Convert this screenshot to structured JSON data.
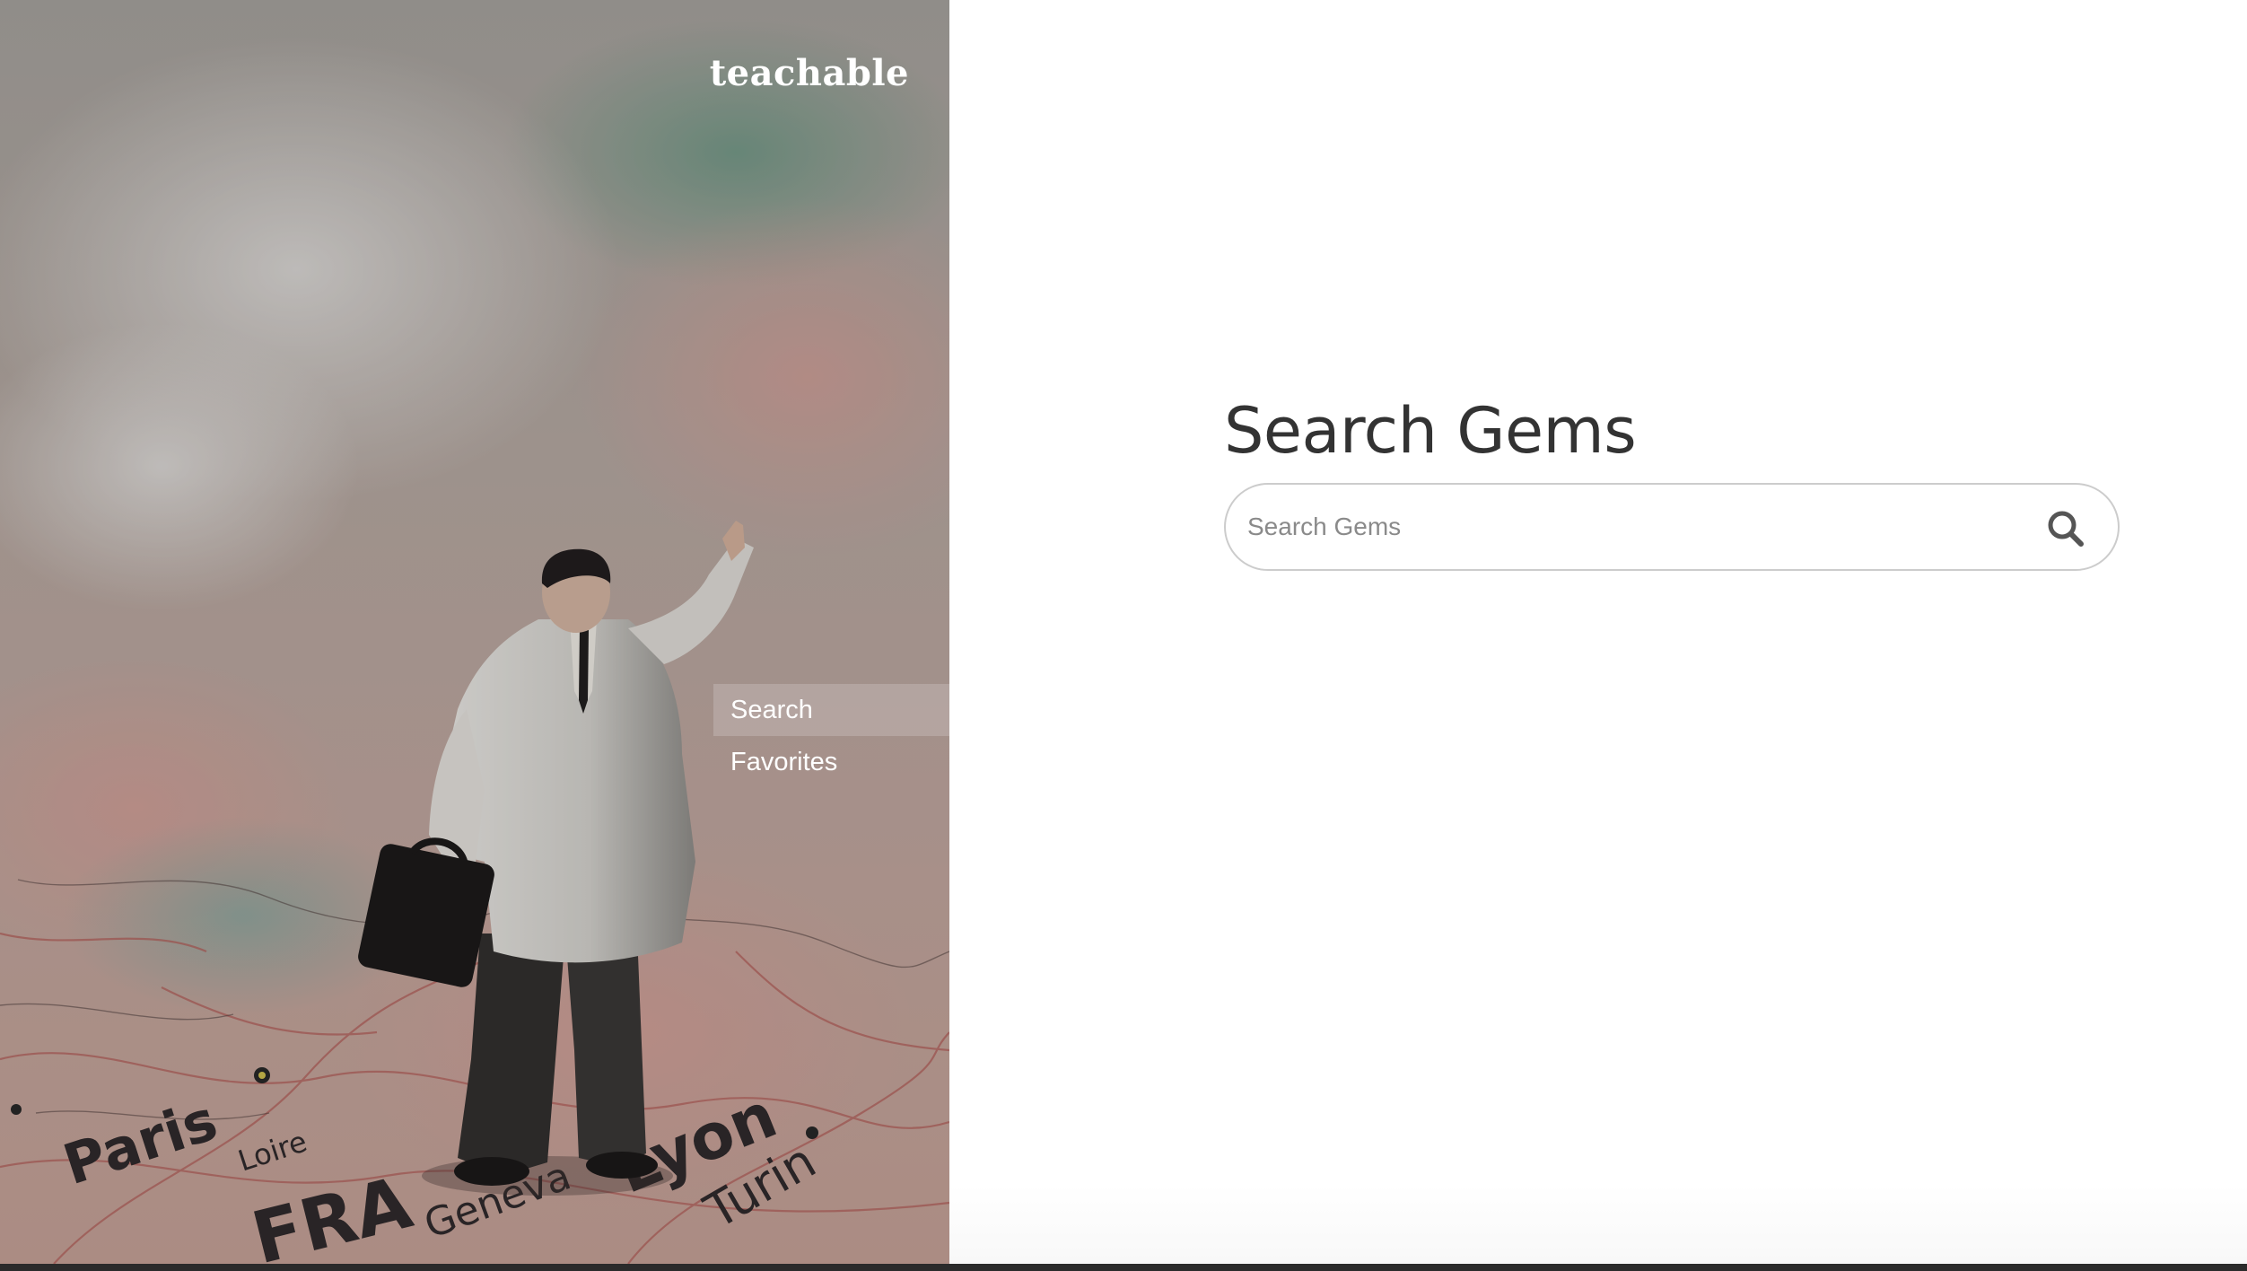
{
  "brand": {
    "logo_text": "teachable"
  },
  "sidebar": {
    "items": [
      {
        "label": "Search",
        "active": true
      },
      {
        "label": "Favorites",
        "active": false
      }
    ]
  },
  "main": {
    "title": "Search Gems",
    "search": {
      "placeholder": "Search Gems",
      "value": "",
      "button_icon": "search-icon"
    }
  },
  "hero": {
    "image": "miniature-businessman-figure-on-map",
    "map_labels": [
      "Paris",
      "Loire",
      "FRA",
      "Geneva",
      "Lyon",
      "Turin"
    ]
  },
  "colors": {
    "title_text": "#333333",
    "search_border": "#cccccc",
    "nav_text": "#ffffff"
  }
}
